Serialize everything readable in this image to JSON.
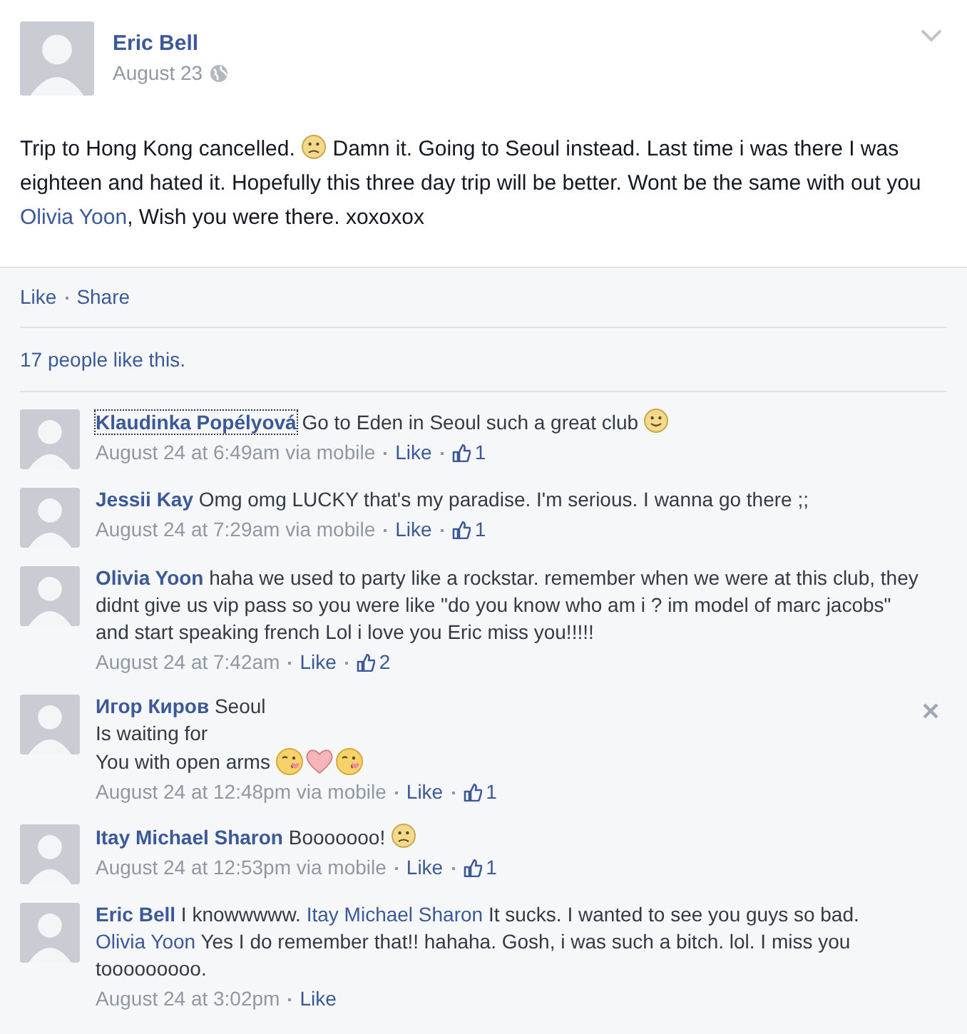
{
  "post": {
    "author": "Eric Bell",
    "date": "August 23",
    "body": [
      {
        "kind": "text",
        "text": "Trip to Hong Kong cancelled. "
      },
      {
        "kind": "frown"
      },
      {
        "kind": "text",
        "text": " Damn it. Going to Seoul instead. Last time i was there I was eighteen and hated it. Hopefully this three day trip will be better. Wont be the same with out you "
      },
      {
        "kind": "mention",
        "text": "Olivia Yoon"
      },
      {
        "kind": "text",
        "text": ", Wish you were there. xoxoxox"
      }
    ],
    "actions": [
      "Like",
      "Share"
    ],
    "likes_summary": "17 people like this."
  },
  "comments": [
    {
      "author": "Klaudinka Popélyová",
      "focused": true,
      "body": [
        {
          "kind": "text",
          "text": "Go to Eden in Seoul such a great club "
        },
        {
          "kind": "smile"
        }
      ],
      "time": "August 24 at 6:49am via mobile",
      "like": "Like",
      "likes": "1"
    },
    {
      "author": "Jessii Kay",
      "body": [
        {
          "kind": "text",
          "text": "Omg omg LUCKY that's my paradise. I'm serious. I wanna go there ;;"
        }
      ],
      "time": "August 24 at 7:29am via mobile",
      "like": "Like",
      "likes": "1"
    },
    {
      "author": "Olivia Yoon",
      "body": [
        {
          "kind": "text",
          "text": "haha we used to party like a rockstar. remember when we were at this club, they didnt give us vip pass so you were like \"do you know who am i ? im model of marc jacobs\" and start speaking french Lol i love you Eric miss you!!!!!"
        }
      ],
      "time": "August 24 at 7:42am",
      "like": "Like",
      "likes": "2"
    },
    {
      "author": "Игор Киров",
      "remove_button": true,
      "body": [
        {
          "kind": "text",
          "text": "Seoul\nIs waiting for\nYou with open arms "
        },
        {
          "kind": "kiss"
        },
        {
          "kind": "heart"
        },
        {
          "kind": "kiss"
        }
      ],
      "time": "August 24 at 12:48pm via mobile",
      "like": "Like",
      "likes": "1"
    },
    {
      "author": "Itay Michael Sharon",
      "body": [
        {
          "kind": "text",
          "text": "Booooooo! "
        },
        {
          "kind": "frown"
        }
      ],
      "time": "August 24 at 12:53pm via mobile",
      "like": "Like",
      "likes": "1"
    },
    {
      "author": "Eric Bell",
      "body": [
        {
          "kind": "text",
          "text": "I knowwwww. "
        },
        {
          "kind": "mention",
          "text": "Itay Michael Sharon"
        },
        {
          "kind": "text",
          "text": " It sucks. I wanted to see you guys so bad. "
        },
        {
          "kind": "mention",
          "text": "Olivia Yoon"
        },
        {
          "kind": "text",
          "text": " Yes I do remember that!! hahaha. Gosh, i was such a bitch. lol. I miss you tooooooooo."
        }
      ],
      "time": "August 24 at 3:02pm",
      "like": "Like"
    }
  ]
}
